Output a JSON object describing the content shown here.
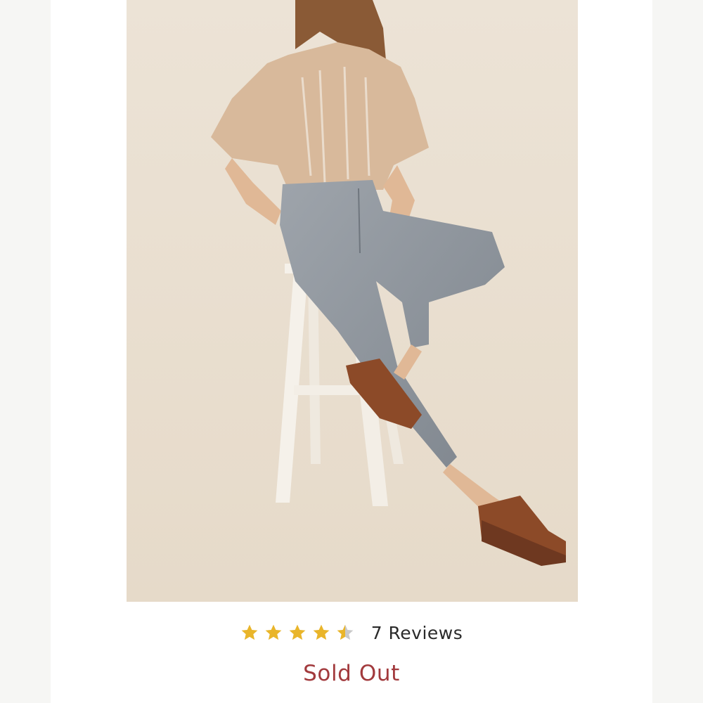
{
  "product": {
    "image": {
      "description": "Model seated on white stool wearing floral peasant blouse, light grey skinny jeans and brown platform sandals"
    },
    "rating": {
      "value": 4.5,
      "max": 5,
      "star_color": "#e9b52a",
      "empty_color": "#c9c9c9",
      "reviews_label": "7 Reviews"
    },
    "status_label": "Sold Out",
    "status_color": "#a23a3d"
  }
}
